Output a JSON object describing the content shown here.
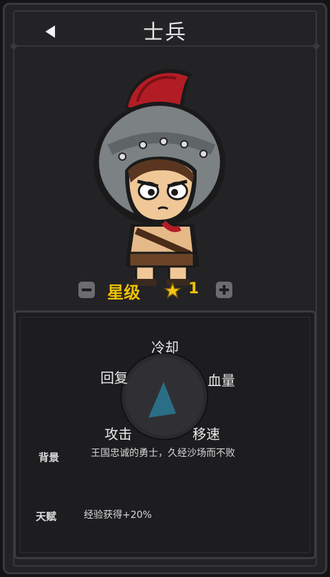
{
  "header": {
    "title": "士兵"
  },
  "stars": {
    "label": "星级",
    "value": "1"
  },
  "stats": {
    "cooldown": "冷却",
    "heal": "回复",
    "health": "血量",
    "attack": "攻击",
    "speed": "移速"
  },
  "info": {
    "background_label": "背景",
    "background_text": "王国忠诚的勇士，久经沙场而不败",
    "talent_label": "天赋",
    "talent_text": "经验获得+20%"
  },
  "colors": {
    "accent": "#f2c200",
    "radar_fill": "#2a6f86",
    "panel": "#1d1d20"
  },
  "icons": [
    "back-arrow-icon",
    "star-icon",
    "minus-icon",
    "plus-icon"
  ]
}
